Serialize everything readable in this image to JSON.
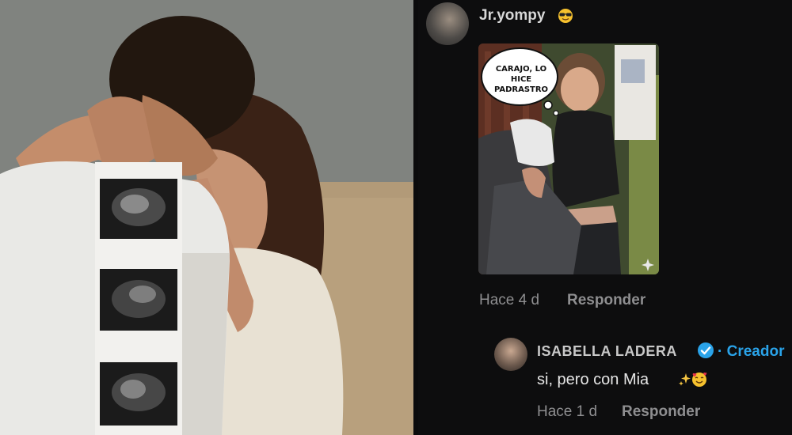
{
  "comments": [
    {
      "username": "Jr.yompy",
      "username_emoji": "sunglasses-face-icon",
      "meme_text": "CARAJO, LO HICE PADRASTRO",
      "time": "Hace 4 d",
      "reply_label": "Responder"
    },
    {
      "username": "ISABELLA LADERA",
      "badge_icon": "verified-check-icon",
      "badge_label": "· Creador",
      "text": "si, pero con Mia",
      "text_emojis": [
        "sparkles-icon",
        "smiling-face-with-hearts-icon"
      ],
      "time": "Hace 1 d",
      "reply_label": "Responder"
    }
  ],
  "colors": {
    "panel_background": "#0d0d0e",
    "username": "#d8d8d8",
    "meta": "#8e8e90",
    "creator_accent": "#2aa3e9"
  }
}
